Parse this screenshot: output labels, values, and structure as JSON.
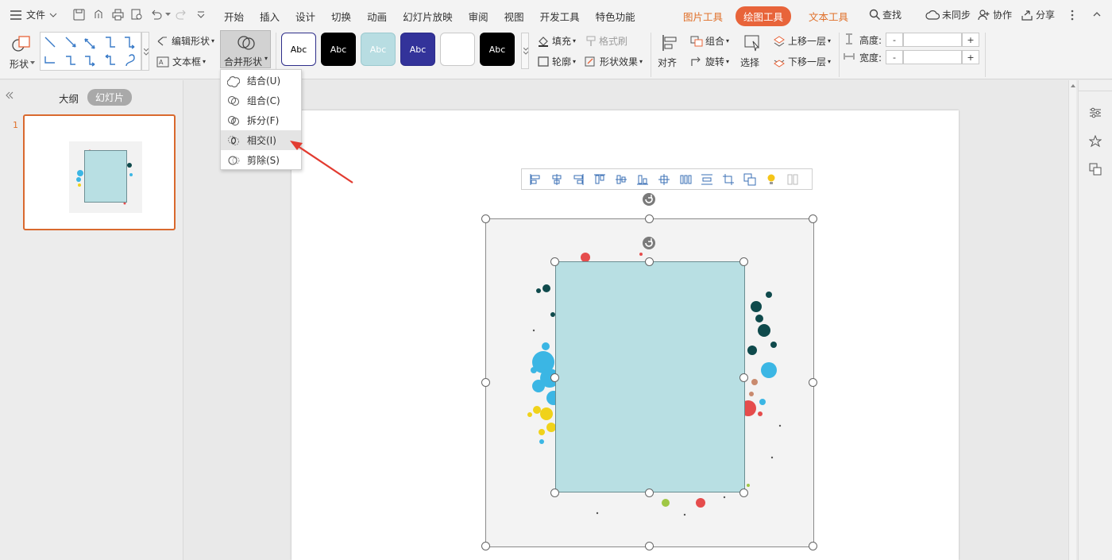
{
  "menubar": {
    "file_label": "文件",
    "tabs": [
      "开始",
      "插入",
      "设计",
      "切换",
      "动画",
      "幻灯片放映",
      "审阅",
      "视图",
      "开发工具",
      "特色功能"
    ],
    "context_tabs": [
      {
        "label": "图片工具",
        "active": false
      },
      {
        "label": "绘图工具",
        "active": true
      },
      {
        "label": "文本工具",
        "active": false
      }
    ],
    "search_label": "查找",
    "sync_label": "未同步",
    "collab_label": "协作",
    "share_label": "分享"
  },
  "ribbon": {
    "shape_label": "形状",
    "edit_shape_label": "编辑形状",
    "textbox_label": "文本框",
    "merge_shape_label": "合并形状",
    "style_boxes": [
      {
        "text": "Abc",
        "bg": "#ffffff",
        "fg": "#000000",
        "border": "#2e2e8a"
      },
      {
        "text": "Abc",
        "bg": "#000000",
        "fg": "#ffffff",
        "border": "#000000"
      },
      {
        "text": "Abc",
        "bg": "#b8dde2",
        "fg": "#ffffff",
        "border": "#9cc9cf"
      },
      {
        "text": "Abc",
        "bg": "#33339a",
        "fg": "#ffffff",
        "border": "#2b2b88"
      },
      {
        "text": "",
        "bg": "#ffffff",
        "fg": "#000000",
        "border": "#c8c8c8"
      },
      {
        "text": "Abc",
        "bg": "#000000",
        "fg": "#ffffff",
        "border": "#000000"
      }
    ],
    "fill_label": "填充",
    "format_brush_label": "格式刷",
    "outline_label": "轮廓",
    "shape_effect_label": "形状效果",
    "align_label": "对齐",
    "group_label": "组合",
    "rotate_label": "旋转",
    "select_label": "选择",
    "bring_forward_label": "上移一层",
    "send_backward_label": "下移一层",
    "height_label": "高度:",
    "width_label": "宽度:",
    "minus": "-",
    "plus": "+"
  },
  "dropdown": {
    "items": [
      {
        "label": "结合(U)",
        "highlighted": false
      },
      {
        "label": "组合(C)",
        "highlighted": false
      },
      {
        "label": "拆分(F)",
        "highlighted": false
      },
      {
        "label": "相交(I)",
        "highlighted": true
      },
      {
        "label": "剪除(S)",
        "highlighted": false
      }
    ]
  },
  "leftpanel": {
    "outline_tab": "大纲",
    "slides_tab": "幻灯片",
    "slide_number": "1"
  },
  "colors": {
    "accent": "#e8643a",
    "selected_border": "#d9692e",
    "rect_fill": "#b8dfe3",
    "arrow_red": "#e23b30"
  }
}
